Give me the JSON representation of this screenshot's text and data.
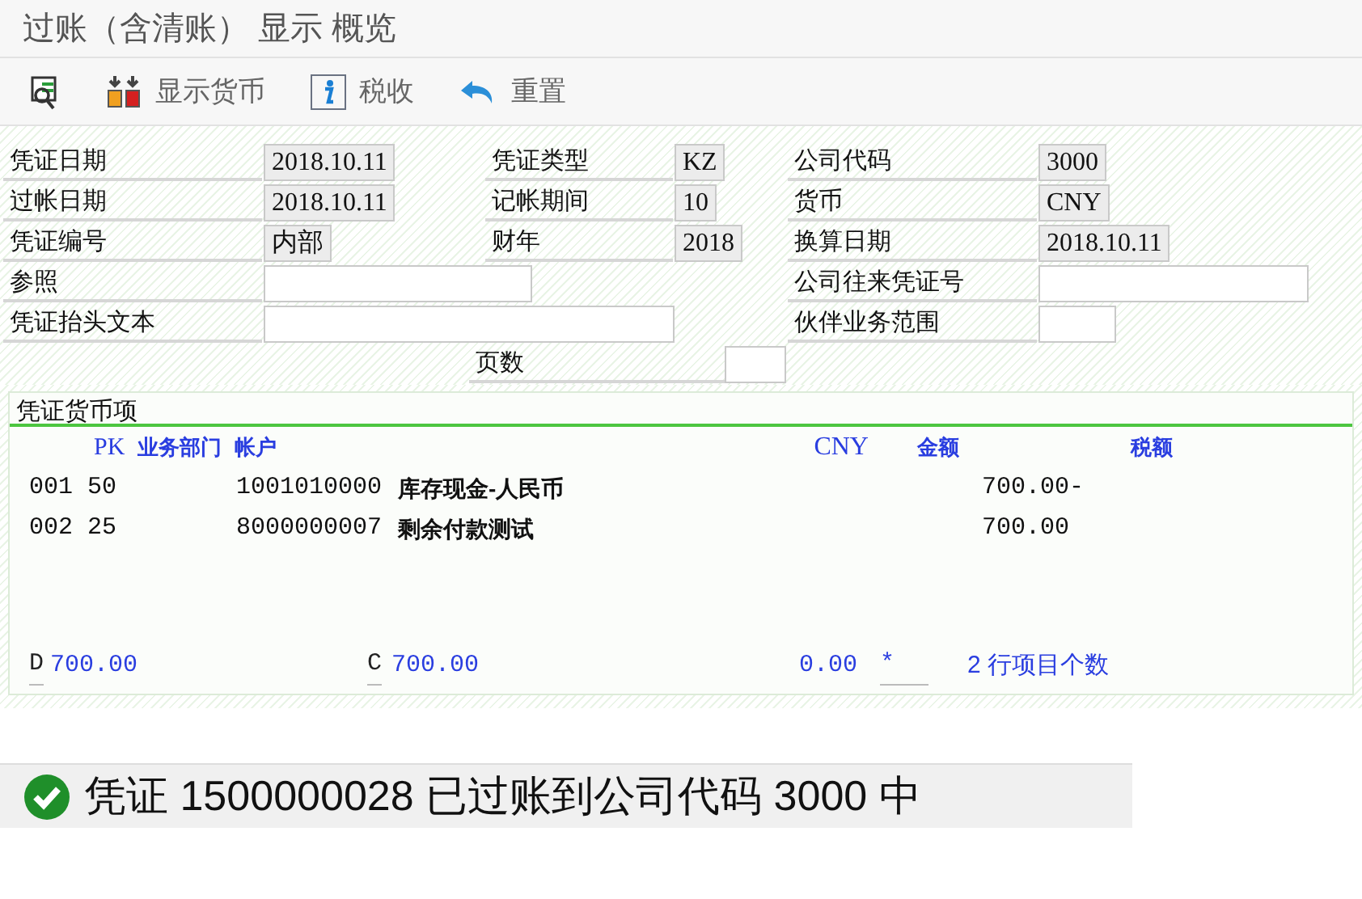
{
  "window": {
    "title": "过账（含清账） 显示 概览"
  },
  "toolbar": [
    {
      "kind": "inspect"
    },
    {
      "kind": "currency",
      "label": "显示货币"
    },
    {
      "kind": "info",
      "label": "税收"
    },
    {
      "kind": "undo",
      "label": "重置"
    }
  ],
  "header": {
    "left": [
      {
        "label": "凭证日期",
        "value": "2018.10.11",
        "kind": "display"
      },
      {
        "label": "过帐日期",
        "value": "2018.10.11",
        "kind": "display"
      },
      {
        "label": "凭证编号",
        "value": "内部",
        "kind": "display"
      },
      {
        "label": "参照",
        "kind": "input"
      },
      {
        "label": "凭证抬头文本",
        "kind": "input"
      }
    ],
    "middle": [
      {
        "label": "凭证类型",
        "value": "KZ",
        "kind": "display"
      },
      {
        "label": "记帐期间",
        "value": "10",
        "kind": "display"
      },
      {
        "label": "财年",
        "value": "2018",
        "kind": "display"
      }
    ],
    "right": [
      {
        "label": "公司代码",
        "value": "3000",
        "kind": "display"
      },
      {
        "label": "货币",
        "value": "CNY",
        "kind": "display"
      },
      {
        "label": "换算日期",
        "value": "2018.10.11",
        "kind": "display"
      },
      {
        "label": "公司往来凭证号",
        "kind": "input"
      },
      {
        "label": "伙伴业务范围",
        "kind": "input"
      }
    ],
    "page_count": {
      "label": "页数"
    }
  },
  "items": {
    "title": "凭证货币项",
    "columns": [
      "PK",
      "业务部门",
      "帐户",
      "CNY",
      "金额",
      "税额"
    ],
    "rows": [
      {
        "line": "001",
        "pk": "50",
        "account": "1001010000",
        "name": "库存现金-人民币",
        "amount": "700.00-"
      },
      {
        "line": "002",
        "pk": "25",
        "account": "8000000007",
        "name": "剩余付款测试",
        "amount": "700.00"
      }
    ],
    "totals": {
      "debit_label": "D",
      "debit": "700.00",
      "credit_label": "C",
      "credit": "700.00",
      "balance": "0.00",
      "flag": "*",
      "count": "2",
      "count_label": "行项目个数"
    }
  },
  "status_bar": {
    "kind": "success",
    "message": "凭证 1500000028 已过账到公司代码 3000 中"
  }
}
